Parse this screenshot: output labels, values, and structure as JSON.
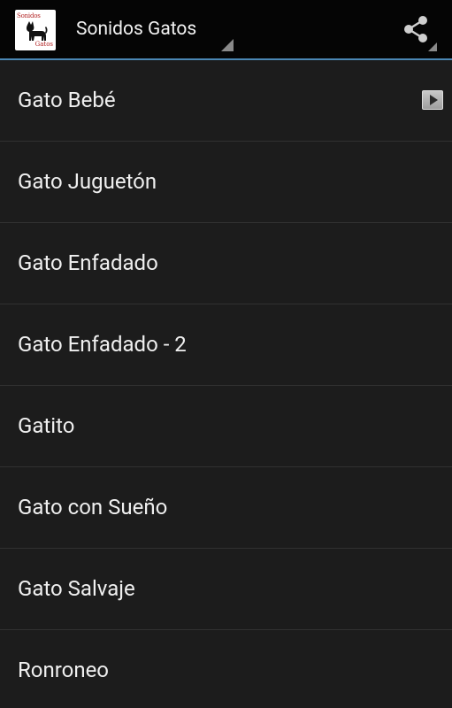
{
  "action_bar": {
    "title": "Sonidos Gatos",
    "app_icon": {
      "name": "cat-logo-icon",
      "text_top": "Sonidos",
      "text_bottom": "Gatos"
    },
    "share_icon": "share-icon"
  },
  "list": {
    "items": [
      {
        "label": "Gato Bebé",
        "has_play_icon": true
      },
      {
        "label": "Gato Juguetón"
      },
      {
        "label": "Gato Enfadado"
      },
      {
        "label": "Gato Enfadado - 2"
      },
      {
        "label": "Gatito"
      },
      {
        "label": "Gato con Sueño"
      },
      {
        "label": "Gato Salvaje"
      },
      {
        "label": "Ronroneo"
      }
    ]
  },
  "colors": {
    "action_bar_bg": "#050505",
    "accent_divider": "#4a87b4",
    "list_bg": "#1c1c1c",
    "divider": "#313131",
    "text": "#f0f0f0"
  }
}
